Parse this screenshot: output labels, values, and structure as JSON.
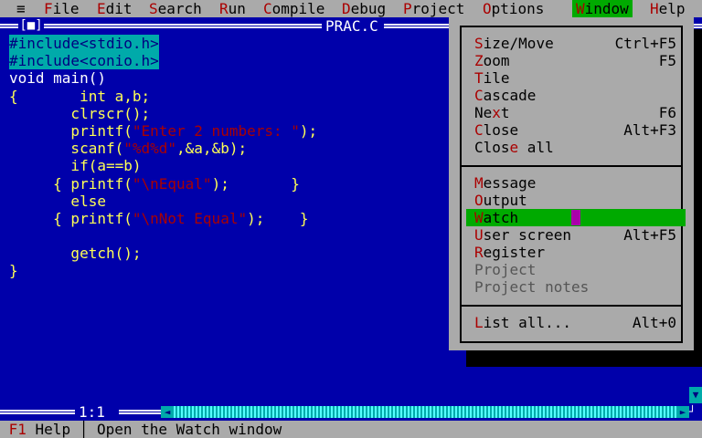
{
  "menubar": {
    "system": "≡",
    "items": [
      {
        "hot": "F",
        "rest": "ile"
      },
      {
        "hot": "E",
        "rest": "dit"
      },
      {
        "hot": "S",
        "rest": "earch"
      },
      {
        "hot": "R",
        "rest": "un"
      },
      {
        "hot": "C",
        "rest": "ompile"
      },
      {
        "hot": "D",
        "rest": "ebug"
      },
      {
        "hot": "P",
        "rest": "roject"
      },
      {
        "hot": "O",
        "rest": "ptions"
      },
      {
        "hot": "W",
        "rest": "indow"
      },
      {
        "hot": "H",
        "rest": "elp"
      }
    ]
  },
  "editor": {
    "title": "PRAC.C",
    "close_box": "[■]",
    "position": "1:1",
    "lines": {
      "l1": "#include<stdio.h>",
      "l2": "#include<conio.h>",
      "l3": "void main()",
      "l4a": "{",
      "l4b": "       int a,b;",
      "l5": "       clrscr();",
      "l6a": "       printf(",
      "l6s": "\"Enter 2 numbers: \"",
      "l6b": ");",
      "l7a": "       scanf(",
      "l7s": "\"%d%d\"",
      "l7b": ",&a,&b);",
      "l8": "       if(a==b)",
      "l9a": "     { printf(",
      "l9s": "\"\\nEqual\"",
      "l9b": ");       }",
      "l10": "       else",
      "l11a": "     { printf(",
      "l11s": "\"\\nNot Equal\"",
      "l11b": ");    }",
      "l12": "",
      "l13": "       getch();",
      "l14": "}"
    }
  },
  "window_menu": {
    "items": [
      {
        "pre": "",
        "hot": "S",
        "post": "ize/Move",
        "shortcut": "Ctrl+F5"
      },
      {
        "pre": "",
        "hot": "Z",
        "post": "oom",
        "shortcut": "F5"
      },
      {
        "pre": "",
        "hot": "T",
        "post": "ile",
        "shortcut": ""
      },
      {
        "pre": "",
        "hot": "C",
        "post": "ascade",
        "shortcut": ""
      },
      {
        "pre": "Ne",
        "hot": "x",
        "post": "t",
        "shortcut": "F6"
      },
      {
        "pre": "",
        "hot": "C",
        "post": "lose",
        "shortcut": "Alt+F3"
      },
      {
        "pre": "Clos",
        "hot": "e",
        "post": " all",
        "shortcut": ""
      },
      {
        "pre": "",
        "hot": "M",
        "post": "essage",
        "shortcut": ""
      },
      {
        "pre": "",
        "hot": "O",
        "post": "utput",
        "shortcut": ""
      },
      {
        "pre": "",
        "hot": "W",
        "post": "atch",
        "shortcut": ""
      },
      {
        "pre": "",
        "hot": "U",
        "post": "ser screen",
        "shortcut": "Alt+F5"
      },
      {
        "pre": "",
        "hot": "R",
        "post": "egister",
        "shortcut": ""
      },
      {
        "pre": "",
        "hot": "",
        "post": "Project",
        "shortcut": ""
      },
      {
        "pre": "",
        "hot": "",
        "post": "Project notes",
        "shortcut": ""
      },
      {
        "pre": "",
        "hot": "L",
        "post": "ist all...",
        "shortcut": "Alt+0"
      }
    ]
  },
  "statusbar": {
    "key": "F1",
    "key_label": " Help",
    "divider": " │ ",
    "message": "Open the Watch window"
  },
  "colors": {
    "background": "#0000aa",
    "menu": "#aaaaaa",
    "highlight": "#00aa00",
    "hotkey": "#aa0000"
  }
}
